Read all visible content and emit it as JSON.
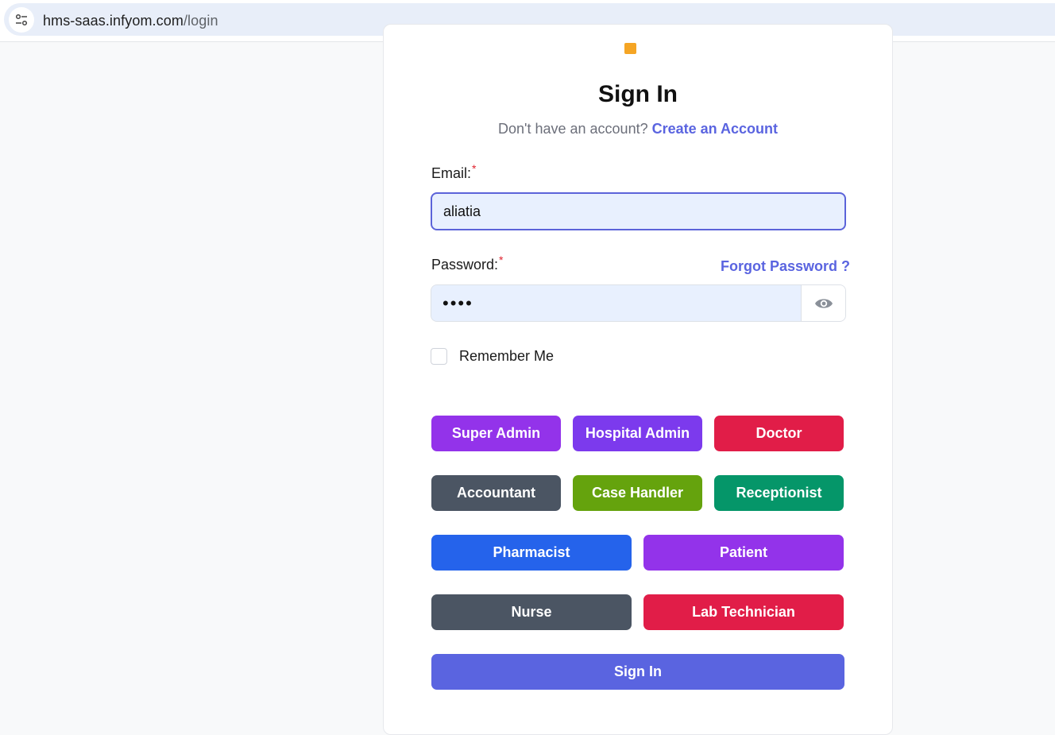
{
  "browser": {
    "url_host": "hms-saas.infyom.com",
    "url_path": "/login"
  },
  "colors": {
    "primary": "#5a64e0",
    "super_admin": "#9333ea",
    "hospital_admin": "#7c3aed",
    "doctor": "#e11d48",
    "accountant": "#4b5563",
    "case_handler": "#65a30d",
    "receptionist": "#059669",
    "pharmacist": "#2563eb",
    "patient": "#9333ea",
    "nurse": "#4b5563",
    "lab_technician": "#e11d48"
  },
  "form": {
    "title": "Sign In",
    "no_account_text": "Don't have an account?",
    "create_account_link": "Create an Account",
    "email_label": "Email:",
    "email_value": "aliatia",
    "password_label": "Password:",
    "password_value": "••••",
    "forgot_password_link": "Forgot Password ?",
    "required_marker": "*",
    "remember_me_label": "Remember Me",
    "submit_label": "Sign In"
  },
  "roles": {
    "super_admin": "Super Admin",
    "hospital_admin": "Hospital Admin",
    "doctor": "Doctor",
    "accountant": "Accountant",
    "case_handler": "Case Handler",
    "receptionist": "Receptionist",
    "pharmacist": "Pharmacist",
    "patient": "Patient",
    "nurse": "Nurse",
    "lab_technician": "Lab Technician"
  },
  "icons": {
    "site_info": "tune-icon",
    "show_password": "eye-icon"
  }
}
